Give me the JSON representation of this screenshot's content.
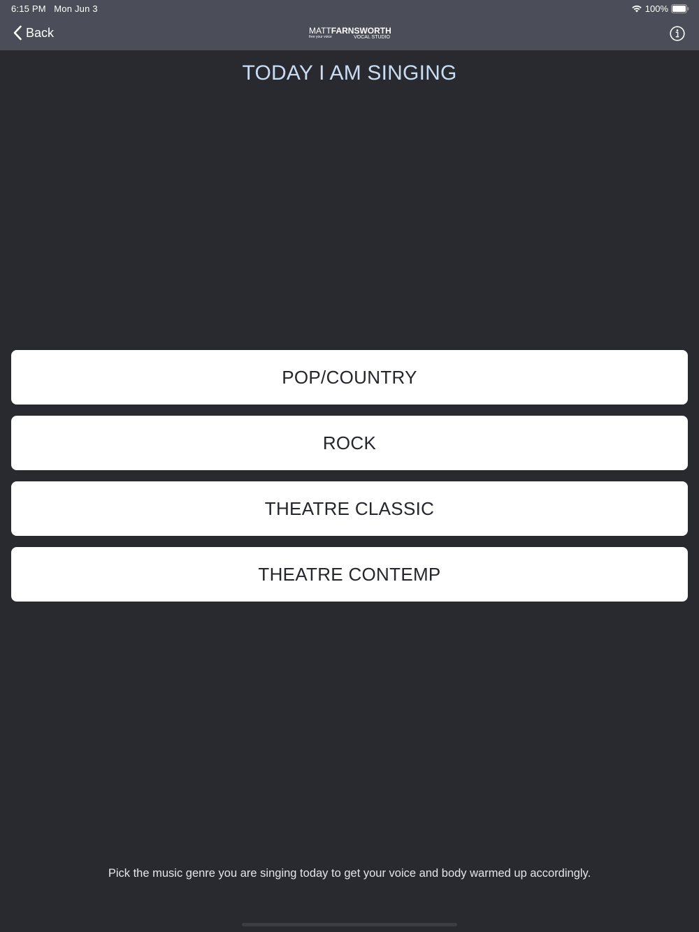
{
  "status_bar": {
    "time_date": "6:15 PM   Mon Jun 3",
    "battery_percent": "100%",
    "battery_level": 1.0,
    "icons": [
      "wifi-icon",
      "battery-icon"
    ]
  },
  "nav": {
    "back_label": "Back",
    "back_icon": "chevron-left-icon",
    "info_icon": "info-icon",
    "logo": {
      "name_thin": "MATT",
      "name_bold": "FARNSWORTH",
      "tagline": "free your voice",
      "subtitle": "VOCAL STUDIO"
    }
  },
  "main": {
    "title": "TODAY I AM SINGING",
    "genres": [
      {
        "label": "POP/COUNTRY"
      },
      {
        "label": "ROCK"
      },
      {
        "label": "THEATRE CLASSIC"
      },
      {
        "label": "THEATRE CONTEMP"
      }
    ],
    "hint": "Pick the music genre you are singing today to get your voice and body warmed up accordingly."
  },
  "colors": {
    "background": "#282a2f",
    "nav_bar": "#4b4e58",
    "title_text": "#c9dcf2",
    "button_bg": "#ffffff",
    "button_text": "#24262b"
  }
}
